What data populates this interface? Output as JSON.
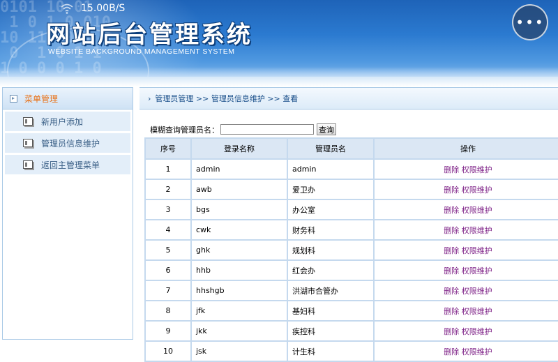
{
  "status_bar": {
    "speed": "15.00B/S"
  },
  "header": {
    "title": "网站后台管理系统",
    "subtitle": "WEBSITE BACKGROUND MANAGEMENT SYSTEM",
    "more_label": "•••"
  },
  "sidebar": {
    "title": "菜单管理",
    "items": [
      {
        "label": "新用户添加"
      },
      {
        "label": "管理员信息维护"
      },
      {
        "label": "返回主管理菜单"
      }
    ]
  },
  "breadcrumb": {
    "chevron": "›",
    "text": "管理员管理 >> 管理员信息维护 >> 查看"
  },
  "search": {
    "label": "模糊查询管理员名：",
    "value": "",
    "button": "查询"
  },
  "table": {
    "headers": [
      "序号",
      "登录名称",
      "管理员名",
      "操作"
    ],
    "rows": [
      {
        "no": "1",
        "login": "admin",
        "name": "admin",
        "delete": "删除",
        "perm": "权限维护"
      },
      {
        "no": "2",
        "login": "awb",
        "name": "爱卫办",
        "delete": "删除",
        "perm": "权限维护"
      },
      {
        "no": "3",
        "login": "bgs",
        "name": "办公室",
        "delete": "删除",
        "perm": "权限维护"
      },
      {
        "no": "4",
        "login": "cwk",
        "name": "财务科",
        "delete": "删除",
        "perm": "权限维护"
      },
      {
        "no": "5",
        "login": "ghk",
        "name": "规划科",
        "delete": "删除",
        "perm": "权限维护"
      },
      {
        "no": "6",
        "login": "hhb",
        "name": "红会办",
        "delete": "删除",
        "perm": "权限维护"
      },
      {
        "no": "7",
        "login": "hhshgb",
        "name": "洪湖市合管办",
        "delete": "删除",
        "perm": "权限维护"
      },
      {
        "no": "8",
        "login": "jfk",
        "name": "基妇科",
        "delete": "删除",
        "perm": "权限维护"
      },
      {
        "no": "9",
        "login": "jkk",
        "name": "疾控科",
        "delete": "删除",
        "perm": "权限维护"
      },
      {
        "no": "10",
        "login": "jsk",
        "name": "计生科",
        "delete": "删除",
        "perm": "权限维护"
      }
    ]
  },
  "colors": {
    "accent_orange": "#e8731a",
    "link_purple": "#7d1f86",
    "header_blue": "#2b7ad0"
  }
}
